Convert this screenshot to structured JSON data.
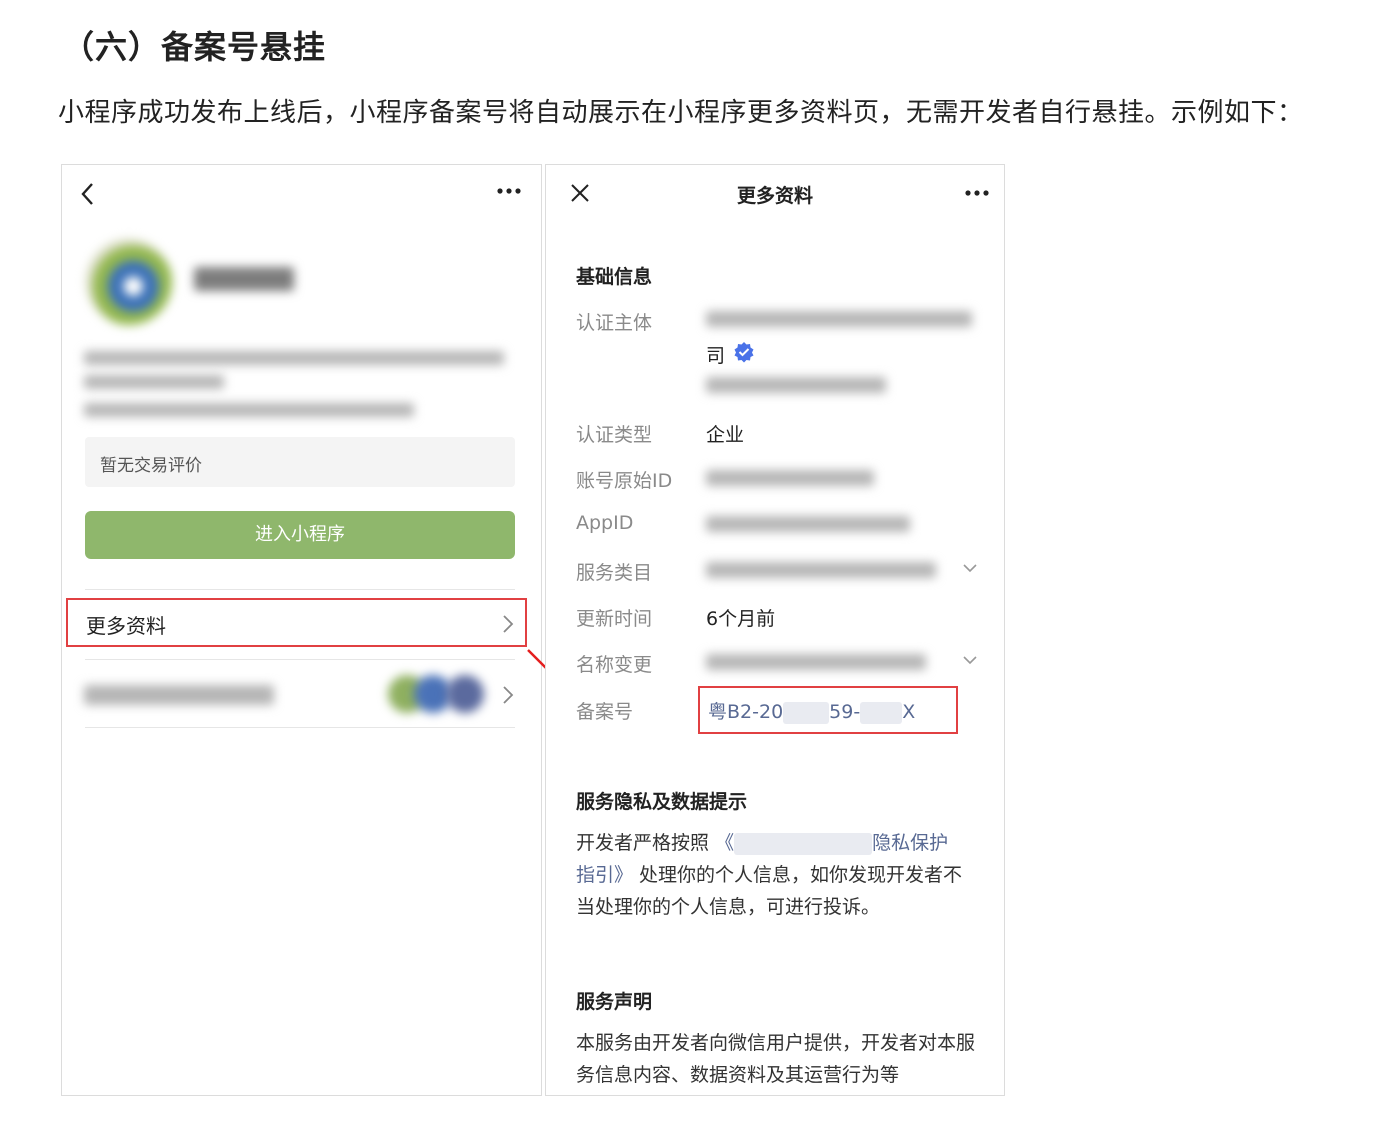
{
  "heading": "（六）备案号悬挂",
  "intro": "小程序成功发布上线后，小程序备案号将自动展示在小程序更多资料页，无需开发者自行悬挂。示例如下：",
  "left_phone": {
    "review_text": "暂无交易评价",
    "enter_button": "进入小程序",
    "more_info_label": "更多资料"
  },
  "right_phone": {
    "title": "更多资料",
    "basic_section": "基础信息",
    "rows": {
      "auth_subject_label": "认证主体",
      "auth_subject_tail": "司",
      "auth_type_label": "认证类型",
      "auth_type_value": "企业",
      "account_id_label": "账号原始ID",
      "appid_label": "AppID",
      "service_category_label": "服务类目",
      "update_time_label": "更新时间",
      "update_time_value": "6个月前",
      "name_change_label": "名称变更",
      "record_label": "备案号",
      "record_prefix": "粤B2-20",
      "record_mid": "59-",
      "record_suffix": "X"
    },
    "privacy_section": "服务隐私及数据提示",
    "privacy_para": {
      "part1": "开发者严格按照",
      "link_open": "《",
      "link_tail": "隐私保护",
      "link_end": "指引》",
      "part2": " 处理你的个人信息，如你发现开发者不当处理你的个人信息，可进行投诉。"
    },
    "statement_section": "服务声明",
    "statement_para": "本服务由开发者向微信用户提供，开发者对本服务信息内容、数据资料及其运营行为等"
  },
  "colors": {
    "highlight_red": "#e14042",
    "button_green": "#8fb76c",
    "link_blue": "#586993",
    "verified_blue": "#4a72e8"
  },
  "icons": [
    "back-chevron-icon",
    "more-dots-icon",
    "close-x-icon",
    "chevron-right-icon",
    "chevron-down-icon",
    "verified-badge-icon",
    "red-arrow-icon"
  ]
}
